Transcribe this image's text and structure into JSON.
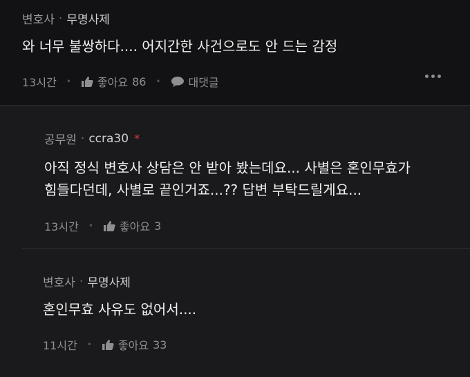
{
  "comments": [
    {
      "author_role": "변호사",
      "separator": "·",
      "author_name": "무명사제",
      "body_lines": [
        "와 너무 불쌍하다.... 어지간한 사건으로도 안 드는 감정"
      ],
      "time": "13시간",
      "like_label": "좋아요",
      "like_count": "86",
      "reply_label": "대댓글"
    },
    {
      "author_role": "공무원",
      "separator": "·",
      "author_name": "ccra30",
      "author_mark": "*",
      "body_lines": [
        "아직 정식 변호사 상담은 안 받아 봤는데요... 사별은 혼인무효가",
        "힘들다던데, 사별로 끝인거죠...?? 답변 부탁드릴게요..."
      ],
      "time": "13시간",
      "like_label": "좋아요",
      "like_count": "3"
    },
    {
      "author_role": "변호사",
      "separator": "·",
      "author_name": "무명사제",
      "body_lines": [
        "혼인무효 사유도 없어서...."
      ],
      "time": "11시간",
      "like_label": "좋아요",
      "like_count": "33"
    }
  ],
  "icons": {
    "like": "thumbs-up-icon",
    "reply": "speech-bubble-icon",
    "more": "more-horizontal-icon"
  },
  "colors": {
    "background": "#151517",
    "text": "#f0f0f0",
    "muted": "#8f8f93",
    "mark_red": "#d93b3b"
  }
}
